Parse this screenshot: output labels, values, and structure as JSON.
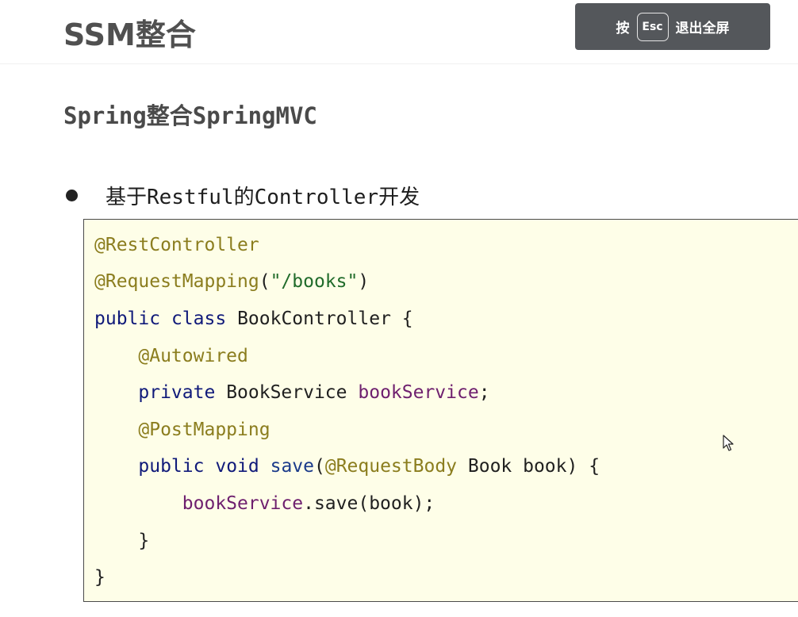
{
  "header": {
    "title": "SSM整合",
    "fullscreen_hint": {
      "prefix": "按",
      "key": "Esc",
      "suffix": "退出全屏"
    }
  },
  "section": {
    "title": "Spring整合SpringMVC"
  },
  "bullet": {
    "text": "基于Restful的Controller开发"
  },
  "code": {
    "line1": {
      "ann": "@RestController"
    },
    "line2": {
      "ann": "@RequestMapping",
      "open": "(",
      "str": "\"/books\"",
      "close": ")"
    },
    "line3": {
      "kw1": "public",
      "kw2": "class",
      "rest": "BookController {"
    },
    "line4": {
      "ann": "@Autowired"
    },
    "line5": {
      "kw": "private",
      "type": "BookService",
      "field": "bookService",
      "end": ";"
    },
    "line6": {
      "ann": "@PostMapping"
    },
    "line7": {
      "kw1": "public",
      "kw2": "void",
      "method": "save",
      "open": "(",
      "ann": "@RequestBody",
      "rest": "Book book) {"
    },
    "line8": {
      "field": "bookService",
      "rest": ".save(book);"
    },
    "line9": {
      "text": "}"
    },
    "line10": {
      "text": "}"
    }
  },
  "colors": {
    "annotation": "#8b7d1e",
    "string": "#206b2a",
    "keyword": "#101a7a",
    "field": "#6e1f6e",
    "code_background": "#fefee8",
    "banner_background": "#54575b"
  }
}
